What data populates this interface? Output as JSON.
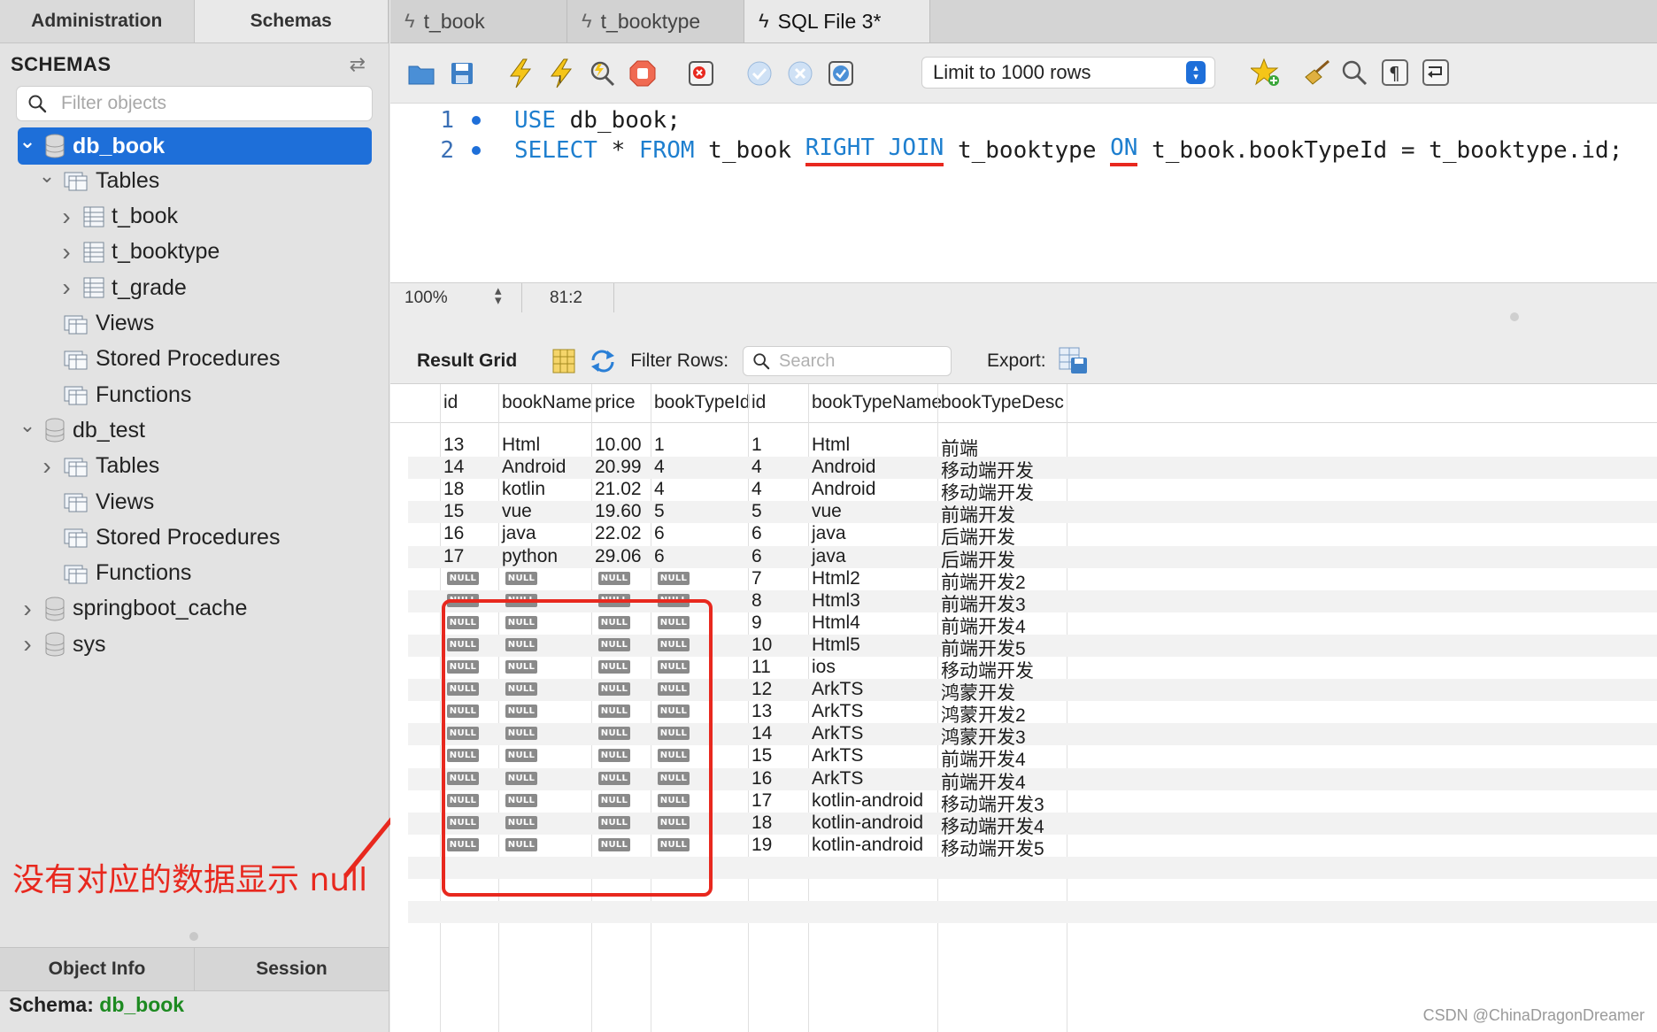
{
  "sidebar": {
    "tabs": [
      "Administration",
      "Schemas"
    ],
    "title": "SCHEMAS",
    "filter_placeholder": "Filter objects",
    "tree": [
      {
        "label": "db_book",
        "level": 0,
        "expanded": true,
        "selected": true,
        "kind": "db"
      },
      {
        "label": "Tables",
        "level": 1,
        "expanded": true,
        "kind": "folder"
      },
      {
        "label": "t_book",
        "level": 2,
        "expanded": false,
        "kind": "table"
      },
      {
        "label": "t_booktype",
        "level": 2,
        "expanded": false,
        "kind": "table"
      },
      {
        "label": "t_grade",
        "level": 2,
        "expanded": false,
        "kind": "table"
      },
      {
        "label": "Views",
        "level": 1,
        "kind": "folder"
      },
      {
        "label": "Stored Procedures",
        "level": 1,
        "kind": "folder"
      },
      {
        "label": "Functions",
        "level": 1,
        "kind": "folder"
      },
      {
        "label": "db_test",
        "level": 0,
        "expanded": true,
        "kind": "db"
      },
      {
        "label": "Tables",
        "level": 1,
        "expanded": false,
        "kind": "folder"
      },
      {
        "label": "Views",
        "level": 1,
        "kind": "folder"
      },
      {
        "label": "Stored Procedures",
        "level": 1,
        "kind": "folder"
      },
      {
        "label": "Functions",
        "level": 1,
        "kind": "folder"
      },
      {
        "label": "springboot_cache",
        "level": 0,
        "expanded": false,
        "kind": "db"
      },
      {
        "label": "sys",
        "level": 0,
        "expanded": false,
        "kind": "db"
      }
    ],
    "annotation": "没有对应的数据显示 null",
    "bottom_tabs": [
      "Object Info",
      "Session"
    ],
    "schema_info": {
      "label": "Schema:",
      "value": "db_book"
    }
  },
  "tabs": [
    {
      "label": "t_book",
      "active": false
    },
    {
      "label": "t_booktype",
      "active": false
    },
    {
      "label": "SQL File 3*",
      "active": true
    }
  ],
  "toolbar": {
    "limit_label": "Limit to 1000 rows"
  },
  "editor": {
    "line1": {
      "num": "1",
      "kw": "USE",
      "rest": " db_book;"
    },
    "line2": {
      "num": "2",
      "kw1": "SELECT",
      "p1": " * ",
      "kw2": "FROM",
      "p2": " t_book ",
      "kw3": "RIGHT JOIN",
      "p3": " t_booktype ",
      "kw4": "ON",
      "p4": " t_book.bookTypeId = t_booktype.id;"
    }
  },
  "status": {
    "zoom": "100%",
    "cursor": "81:2"
  },
  "result": {
    "title": "Result Grid",
    "filter_label": "Filter Rows:",
    "search_placeholder": "Search",
    "export_label": "Export:",
    "columns": [
      "id",
      "bookName",
      "price",
      "bookTypeId",
      "id",
      "bookTypeName",
      "bookTypeDesc"
    ],
    "rows": [
      [
        "13",
        "Html",
        "10.00",
        "1",
        "1",
        "Html",
        "前端"
      ],
      [
        "14",
        "Android",
        "20.99",
        "4",
        "4",
        "Android",
        "移动端开发"
      ],
      [
        "18",
        "kotlin",
        "21.02",
        "4",
        "4",
        "Android",
        "移动端开发"
      ],
      [
        "15",
        "vue",
        "19.60",
        "5",
        "5",
        "vue",
        "前端开发"
      ],
      [
        "16",
        "java",
        "22.02",
        "6",
        "6",
        "java",
        "后端开发"
      ],
      [
        "17",
        "python",
        "29.06",
        "6",
        "6",
        "java",
        "后端开发"
      ],
      [
        null,
        null,
        null,
        null,
        "7",
        "Html2",
        "前端开发2"
      ],
      [
        null,
        null,
        null,
        null,
        "8",
        "Html3",
        "前端开发3"
      ],
      [
        null,
        null,
        null,
        null,
        "9",
        "Html4",
        "前端开发4"
      ],
      [
        null,
        null,
        null,
        null,
        "10",
        "Html5",
        "前端开发5"
      ],
      [
        null,
        null,
        null,
        null,
        "11",
        "ios",
        "移动端开发"
      ],
      [
        null,
        null,
        null,
        null,
        "12",
        "ArkTS",
        "鸿蒙开发"
      ],
      [
        null,
        null,
        null,
        null,
        "13",
        "ArkTS",
        "鸿蒙开发2"
      ],
      [
        null,
        null,
        null,
        null,
        "14",
        "ArkTS",
        "鸿蒙开发3"
      ],
      [
        null,
        null,
        null,
        null,
        "15",
        "ArkTS",
        "前端开发4"
      ],
      [
        null,
        null,
        null,
        null,
        "16",
        "ArkTS",
        "前端开发4"
      ],
      [
        null,
        null,
        null,
        null,
        "17",
        "kotlin-android",
        "移动端开发3"
      ],
      [
        null,
        null,
        null,
        null,
        "18",
        "kotlin-android",
        "移动端开发4"
      ],
      [
        null,
        null,
        null,
        null,
        "19",
        "kotlin-android",
        "移动端开发5"
      ]
    ],
    "null_text": "NULL"
  },
  "watermark": "CSDN @ChinaDragonDreamer",
  "colors": {
    "accent": "#1e6fd9",
    "annotation": "#e8281e",
    "schema_green": "#1d8a21",
    "keyword": "#1e7fcf"
  }
}
